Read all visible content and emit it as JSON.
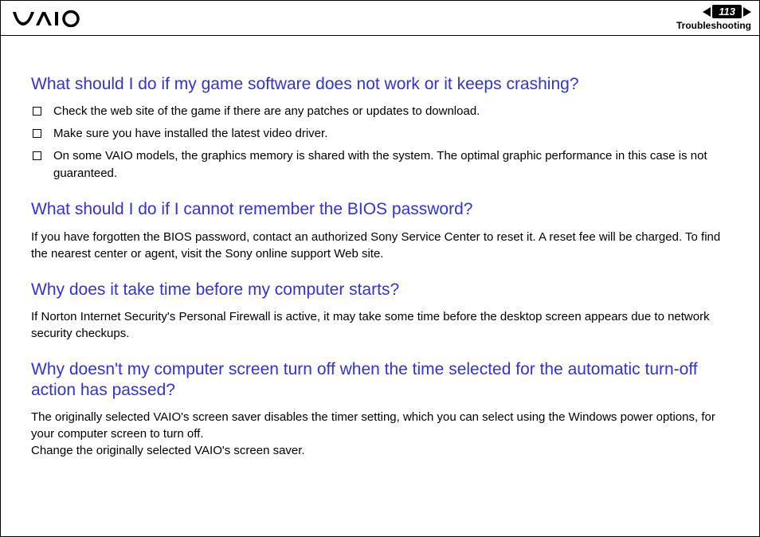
{
  "header": {
    "page_number": "113",
    "section": "Troubleshooting"
  },
  "sections": [
    {
      "heading": "What should I do if my game software does not work or it keeps crashing?",
      "bullets": [
        "Check the web site of the game if there are any patches or updates to download.",
        "Make sure you have installed the latest video driver.",
        "On some VAIO models, the graphics memory is shared with the system. The optimal graphic performance in this case is not guaranteed."
      ]
    },
    {
      "heading": "What should I do if I cannot remember the BIOS password?",
      "paragraphs": [
        "If you have forgotten the BIOS password, contact an authorized Sony Service Center to reset it. A reset fee will be charged. To find the nearest center or agent, visit the Sony online support Web site."
      ]
    },
    {
      "heading": "Why does it take time before my computer starts?",
      "paragraphs": [
        "If Norton Internet Security's Personal Firewall is active, it may take some time before the desktop screen appears due to network security checkups."
      ]
    },
    {
      "heading": "Why doesn't my computer screen turn off when the time selected for the automatic turn-off action has passed?",
      "paragraphs": [
        "The originally selected VAIO's screen saver disables the timer setting, which you can select using the Windows power options, for your computer screen to turn off.",
        "Change the originally selected VAIO's screen saver."
      ]
    }
  ]
}
